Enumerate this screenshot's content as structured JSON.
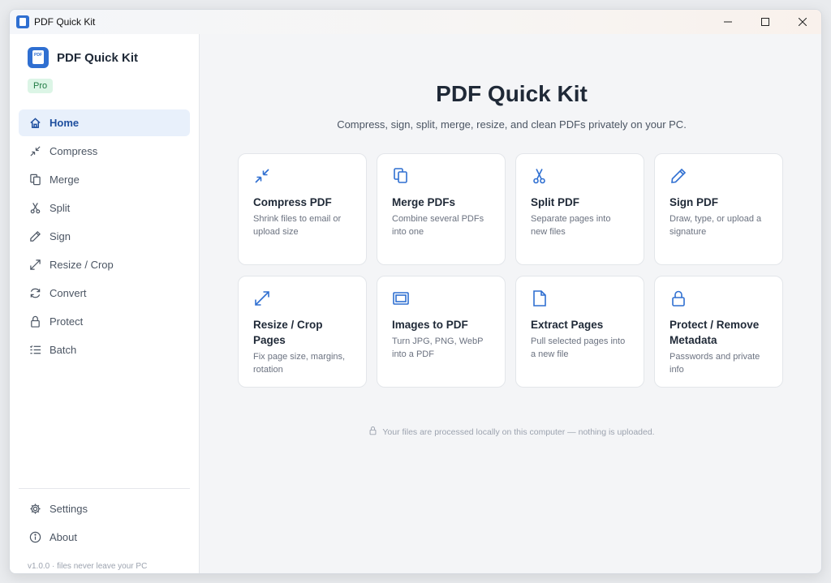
{
  "window": {
    "title": "PDF Quick Kit",
    "controls": {
      "minimize": "—",
      "maximize": "☐",
      "close": "✕"
    }
  },
  "sidebar": {
    "brand": {
      "name": "PDF Quick Kit",
      "logo_text": "PDF",
      "badge": "Pro"
    },
    "items": [
      {
        "label": "Home",
        "icon": "home-icon",
        "active": true
      },
      {
        "label": "Compress",
        "icon": "compress-icon"
      },
      {
        "label": "Merge",
        "icon": "merge-icon"
      },
      {
        "label": "Split",
        "icon": "scissors-icon"
      },
      {
        "label": "Sign",
        "icon": "pen-icon"
      },
      {
        "label": "Resize / Crop",
        "icon": "resize-icon"
      },
      {
        "label": "Convert",
        "icon": "convert-icon"
      },
      {
        "label": "Protect",
        "icon": "lock-icon"
      },
      {
        "label": "Batch",
        "icon": "batch-icon"
      }
    ],
    "bottom_items": [
      {
        "label": "Settings",
        "icon": "gear-icon"
      },
      {
        "label": "About",
        "icon": "info-icon"
      }
    ],
    "version": "v1.0.0 · files never leave your PC"
  },
  "main": {
    "title": "PDF Quick Kit",
    "subtitle": "Compress, sign, split, merge, resize, and clean PDFs privately on your PC.",
    "cards": [
      {
        "title": "Compress PDF",
        "desc": "Shrink files to email or upload size",
        "icon": "compress-icon"
      },
      {
        "title": "Merge PDFs",
        "desc": "Combine several PDFs into one",
        "icon": "merge-icon"
      },
      {
        "title": "Split PDF",
        "desc": "Separate pages into new files",
        "icon": "scissors-icon"
      },
      {
        "title": "Sign PDF",
        "desc": "Draw, type, or upload a signature",
        "icon": "pen-icon"
      },
      {
        "title": "Resize / Crop Pages",
        "desc": "Fix page size, margins, rotation",
        "icon": "resize-icon"
      },
      {
        "title": "Images to PDF",
        "desc": "Turn JPG, PNG, WebP into a PDF",
        "icon": "image-icon"
      },
      {
        "title": "Extract Pages",
        "desc": "Pull selected pages into a new file",
        "icon": "page-icon"
      },
      {
        "title": "Protect / Remove Metadata",
        "desc": "Passwords and private info",
        "icon": "lock-icon"
      }
    ],
    "footer_note": "Your files are processed locally on this computer — nothing is uploaded."
  },
  "colors": {
    "accent": "#2f6fd1",
    "active_bg": "#e8f0fb",
    "pro_badge_bg": "#dcf5e6"
  }
}
